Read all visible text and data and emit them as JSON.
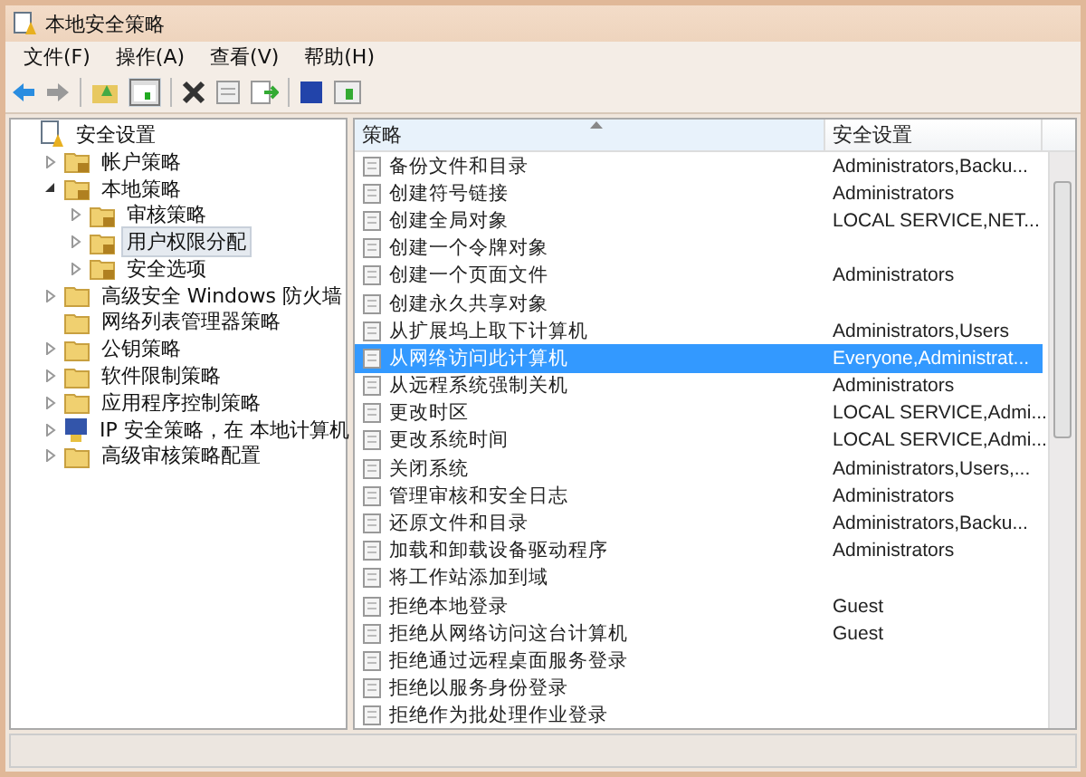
{
  "window": {
    "title": "本地安全策略"
  },
  "menu": [
    "文件(F)",
    "操作(A)",
    "查看(V)",
    "帮助(H)"
  ],
  "tree": [
    {
      "label": "安全设置",
      "kind": "root",
      "selected": false,
      "children": [
        {
          "label": "帐户策略",
          "kind": "locked-folder",
          "expanded": false,
          "selected": false
        },
        {
          "label": "本地策略",
          "kind": "locked-folder",
          "expanded": true,
          "selected": false,
          "children": [
            {
              "label": "审核策略",
              "kind": "locked-folder",
              "expanded": false,
              "selected": false
            },
            {
              "label": "用户权限分配",
              "kind": "locked-folder",
              "expanded": false,
              "selected": true
            },
            {
              "label": "安全选项",
              "kind": "locked-folder",
              "expanded": false,
              "selected": false
            }
          ]
        },
        {
          "label": "高级安全 Windows 防火墙",
          "kind": "folder",
          "expanded": false,
          "selected": false
        },
        {
          "label": "网络列表管理器策略",
          "kind": "folder",
          "selected": false
        },
        {
          "label": "公钥策略",
          "kind": "folder",
          "expanded": false,
          "selected": false
        },
        {
          "label": "软件限制策略",
          "kind": "folder",
          "expanded": false,
          "selected": false
        },
        {
          "label": "应用程序控制策略",
          "kind": "folder",
          "expanded": false,
          "selected": false
        },
        {
          "label": "IP 安全策略，在 本地计算机",
          "kind": "network",
          "expanded": false,
          "selected": false
        },
        {
          "label": "高级审核策略配置",
          "kind": "folder",
          "expanded": false,
          "selected": false
        }
      ]
    }
  ],
  "table": {
    "columns": [
      "策略",
      "安全设置"
    ],
    "rows": [
      {
        "policy": "备份文件和目录",
        "setting": "Administrators,Backu...",
        "selected": false
      },
      {
        "policy": "创建符号链接",
        "setting": "Administrators",
        "selected": false
      },
      {
        "policy": "创建全局对象",
        "setting": "LOCAL SERVICE,NET...",
        "selected": false
      },
      {
        "policy": "创建一个令牌对象",
        "setting": "",
        "selected": false
      },
      {
        "policy": "创建一个页面文件",
        "setting": "Administrators",
        "selected": false
      },
      {
        "policy": "创建永久共享对象",
        "setting": "",
        "selected": false
      },
      {
        "policy": "从扩展坞上取下计算机",
        "setting": "Administrators,Users",
        "selected": false
      },
      {
        "policy": "从网络访问此计算机",
        "setting": "Everyone,Administrat...",
        "selected": true
      },
      {
        "policy": "从远程系统强制关机",
        "setting": "Administrators",
        "selected": false
      },
      {
        "policy": "更改时区",
        "setting": "LOCAL SERVICE,Admi...",
        "selected": false
      },
      {
        "policy": "更改系统时间",
        "setting": "LOCAL SERVICE,Admi...",
        "selected": false
      },
      {
        "policy": "关闭系统",
        "setting": "Administrators,Users,...",
        "selected": false
      },
      {
        "policy": "管理审核和安全日志",
        "setting": "Administrators",
        "selected": false
      },
      {
        "policy": "还原文件和目录",
        "setting": "Administrators,Backu...",
        "selected": false
      },
      {
        "policy": "加载和卸载设备驱动程序",
        "setting": "Administrators",
        "selected": false
      },
      {
        "policy": "将工作站添加到域",
        "setting": "",
        "selected": false
      },
      {
        "policy": "拒绝本地登录",
        "setting": "Guest",
        "selected": false
      },
      {
        "policy": "拒绝从网络访问这台计算机",
        "setting": "Guest",
        "selected": false
      },
      {
        "policy": "拒绝通过远程桌面服务登录",
        "setting": "",
        "selected": false
      },
      {
        "policy": "拒绝以服务身份登录",
        "setting": "",
        "selected": false
      },
      {
        "policy": "拒绝作为批处理作业登录",
        "setting": "",
        "selected": false
      }
    ]
  }
}
